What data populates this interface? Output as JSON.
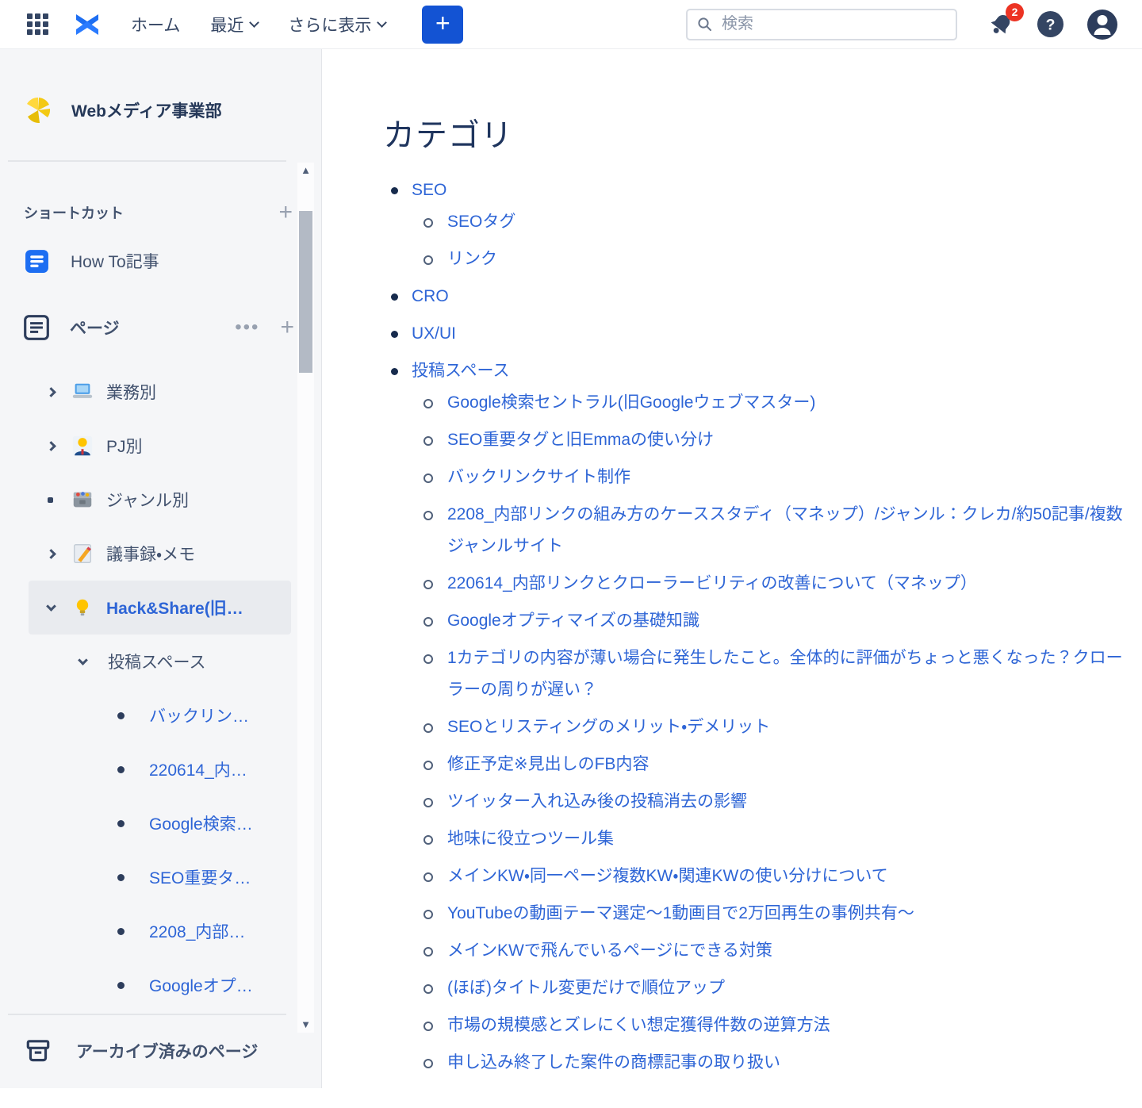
{
  "topbar": {
    "icons": [
      "app-grid-icon",
      "confluence-logo",
      "search-icon",
      "notifications-icon",
      "help-icon",
      "profile-icon"
    ],
    "nav": [
      {
        "label": "ホーム",
        "has_chevron": false
      },
      {
        "label": "最近",
        "has_chevron": true
      },
      {
        "label": "さらに表示",
        "has_chevron": true
      }
    ],
    "create_label": "+",
    "search_placeholder": "検索",
    "notification_count": "2"
  },
  "sidebar": {
    "space_name": "Webメディア事業部",
    "space_logo": "space-logo-icon",
    "shortcuts_title": "ショートカット",
    "shortcut_items": [
      {
        "label": "How To記事",
        "icon": "page-blue-icon"
      }
    ],
    "pages_title": "ページ",
    "pages_icon": "pages-outline-icon",
    "tree": [
      {
        "label": "業務別",
        "icon": "laptop-icon",
        "expander": "chevron-right",
        "level": 1
      },
      {
        "label": "PJ別",
        "icon": "person-bulb-icon",
        "expander": "chevron-right",
        "level": 1
      },
      {
        "label": "ジャンル別",
        "icon": "genre-box-icon",
        "expander": "dot",
        "level": 1
      },
      {
        "label": "議事録・メモ",
        "icon": "memo-icon",
        "expander": "chevron-right",
        "level": 1
      },
      {
        "label": "Hack&Share(旧…",
        "icon": "bulb-icon",
        "expander": "chevron-down",
        "level": 1,
        "selected": true
      },
      {
        "label": "投稿スペース",
        "icon": null,
        "expander": "chevron-down",
        "level": 2
      },
      {
        "label": "バックリン…",
        "expander": "page-dot",
        "level": 3
      },
      {
        "label": "220614_内…",
        "expander": "page-dot",
        "level": 3
      },
      {
        "label": "Google検索…",
        "expander": "page-dot",
        "level": 3
      },
      {
        "label": "SEO重要タ…",
        "expander": "page-dot",
        "level": 3
      },
      {
        "label": "2208_内部…",
        "expander": "page-dot",
        "level": 3
      },
      {
        "label": "Googleオプ…",
        "expander": "page-dot",
        "level": 3
      }
    ],
    "archived_label": "アーカイブ済みのページ",
    "archived_icon": "archive-box-icon"
  },
  "content": {
    "title": "カテゴリ",
    "list": [
      {
        "label": "SEO",
        "children": [
          "SEOタグ",
          "リンク"
        ]
      },
      {
        "label": "CRO",
        "children": []
      },
      {
        "label": "UX/UI",
        "children": []
      },
      {
        "label": "投稿スペース",
        "children": [
          "Google検索セントラル(旧Googleウェブマスター)",
          "SEO重要タグと旧Emmaの使い分け",
          "バックリンクサイト制作",
          "2208_内部リンクの組み方のケーススタディ（マネップ）/ジャンル：クレカ/約50記事/複数ジャンルサイト",
          "220614_内部リンクとクローラービリティの改善について（マネップ）",
          "Googleオプティマイズの基礎知識",
          "1カテゴリの内容が薄い場合に発生したこと。全体的に評価がちょっと悪くなった？クローラーの周りが遅い？",
          "SEOとリスティングのメリット・デメリット",
          "修正予定※見出しのFB内容",
          "ツイッター入れ込み後の投稿消去の影響",
          "地味に役立つツール集",
          "メインKW・同一ページ複数KW・関連KWの使い分けについて",
          "YouTubeの動画テーマ選定〜1動画目で2万回再生の事例共有〜",
          "メインKWで飛んでいるページにできる対策",
          "(ほぼ)タイトル変更だけで順位アップ",
          "市場の規模感とズレにくい想定獲得件数の逆算方法",
          "申し込み終了した案件の商標記事の取り扱い"
        ]
      }
    ]
  },
  "colors": {
    "link_blue": "#2e65d6",
    "create_button_blue": "#1353d3",
    "logo_blue": "#1d6ef2",
    "badge_red": "#ec3323",
    "navy_text": "#344563",
    "sidebar_bg": "#f5f6f8",
    "selected_pill_bg": "#e9ebef"
  }
}
